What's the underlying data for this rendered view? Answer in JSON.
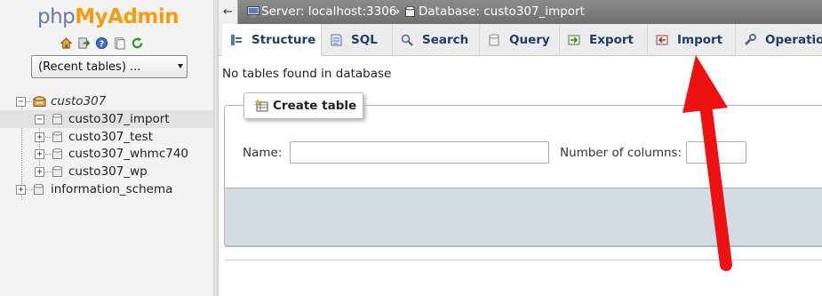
{
  "app": {
    "logo": {
      "php": "php",
      "my": "My",
      "admin": "Admin"
    }
  },
  "nav": {
    "quick_icons": [
      "home-icon",
      "logout-icon",
      "help-icon",
      "docs-icon",
      "reload-icon"
    ],
    "recent_tables": {
      "selected": "(Recent tables) ..."
    },
    "tree": [
      {
        "label": "custo307",
        "italic": true,
        "expander": "−"
      },
      {
        "label": "custo307_import",
        "active": true,
        "expander": "−"
      },
      {
        "label": "custo307_test",
        "expander": "+"
      },
      {
        "label": "custo307_whmc740",
        "expander": "+"
      },
      {
        "label": "custo307_wp",
        "expander": "+"
      },
      {
        "label": "information_schema",
        "expander": "+"
      }
    ]
  },
  "breadcrumb": {
    "back": "←",
    "server": "Server: localhost:3306",
    "separator": "»",
    "database": "Database: custo307_import"
  },
  "tabs": [
    {
      "label": "Structure",
      "active": true,
      "icon": "structure-icon"
    },
    {
      "label": "SQL",
      "icon": "sql-icon"
    },
    {
      "label": "Search",
      "icon": "search-icon"
    },
    {
      "label": "Query",
      "icon": "query-icon"
    },
    {
      "label": "Export",
      "icon": "export-icon"
    },
    {
      "label": "Import",
      "icon": "import-icon"
    },
    {
      "label": "Operations",
      "icon": "operations-icon"
    }
  ],
  "main": {
    "no_tables_message": "No tables found in database",
    "create_table": {
      "legend": "Create table",
      "name_label": "Name:",
      "name_value": "",
      "columns_label": "Number of columns:",
      "columns_value": ""
    }
  },
  "colors": {
    "annotation_arrow": "#ee1111",
    "tab_text": "#1e3d6b",
    "footer": "#d3dce3"
  }
}
